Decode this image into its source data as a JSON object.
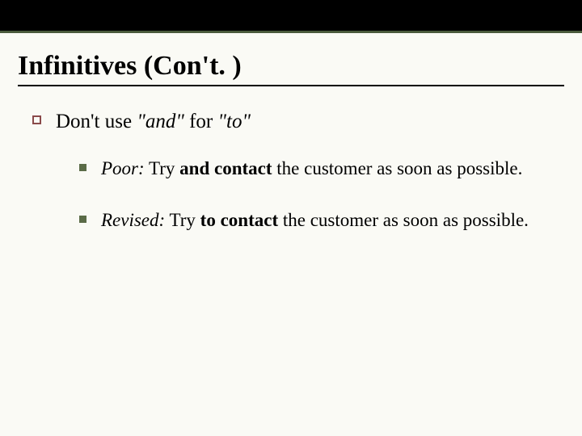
{
  "title": "Infinitives (Con't. )",
  "main_point": {
    "prefix": "Don't use ",
    "italic1": "\"and\"",
    "middle": " for ",
    "italic2": "\"to\""
  },
  "sub1": {
    "label": "Poor:",
    "before": " Try ",
    "bold": "and contact",
    "after": " the customer as soon as possible."
  },
  "sub2": {
    "label": "Revised:",
    "before": " Try ",
    "bold": "to contact",
    "after": " the customer as soon as possible."
  }
}
